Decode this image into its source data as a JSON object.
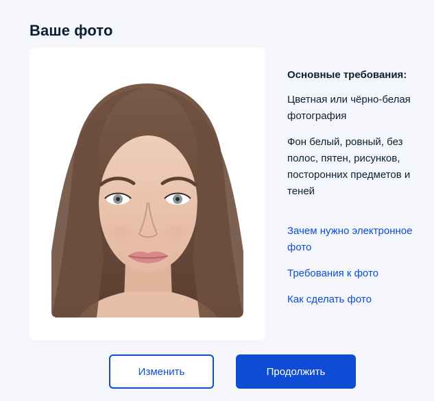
{
  "page": {
    "title": "Ваше фото"
  },
  "photo": {
    "alt": "Пример фотографии"
  },
  "requirements": {
    "heading": "Основные требования:",
    "items": [
      "Цветная или чёрно-белая фотография",
      "Фон белый, ровный, без полос, пятен, рисунков, посторонних предметов и теней"
    ]
  },
  "links": [
    "Зачем нужно электронное фото",
    "Требования к фото",
    "Как сделать фото"
  ],
  "actions": {
    "change_label": "Изменить",
    "continue_label": "Продолжить"
  },
  "colors": {
    "background": "#f4f6fb",
    "accent": "#0d4cd3",
    "text": "#0b1f33"
  }
}
